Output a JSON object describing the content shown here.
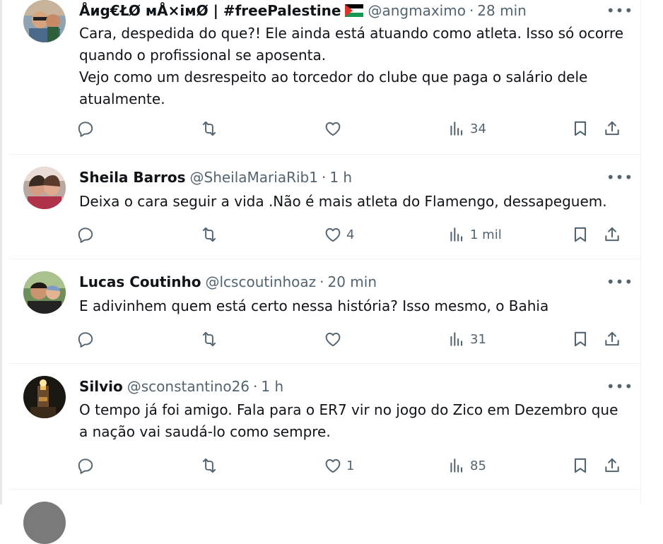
{
  "tweets": [
    {
      "name": "Åиg€ŁØ мÅ×iмØ | #freePalestine",
      "handle": "@angmaximo",
      "time": "28 min",
      "text": "Cara, despedida do que?! Ele ainda está atuando como atleta. Isso só ocorre quando o profissional se aposenta.\nVejo como um desrespeito ao torcedor do clube que paga o salário dele atualmente.",
      "likes": "",
      "views": "34",
      "has_flag": true,
      "flag_icon": "palestine-flag-icon"
    },
    {
      "name": "Sheila Barros",
      "handle": "@SheilaMariaRib1",
      "time": "1 h",
      "text": "Deixa o cara seguir a vida .Não é mais atleta do Flamengo, dessapeguem.",
      "likes": "4",
      "views": "1 mil"
    },
    {
      "name": "Lucas Coutinho",
      "handle": "@lcscoutinhoaz",
      "time": "20 min",
      "text": "E adivinhem quem está certo nessa história? Isso mesmo, o Bahia",
      "likes": "",
      "views": "31"
    },
    {
      "name": "Silvio",
      "handle": "@sconstantino26",
      "time": "1 h",
      "text": "O tempo já foi amigo. Fala para o ER7 vir no jogo do Zico em Dezembro que a nação vai saudá-lo como sempre.",
      "likes": "1",
      "views": "85"
    }
  ],
  "separator": "·",
  "more_glyph": "•••",
  "colors": {
    "text": "#0f1419",
    "secondary": "#536471",
    "border": "#eff3f4"
  }
}
